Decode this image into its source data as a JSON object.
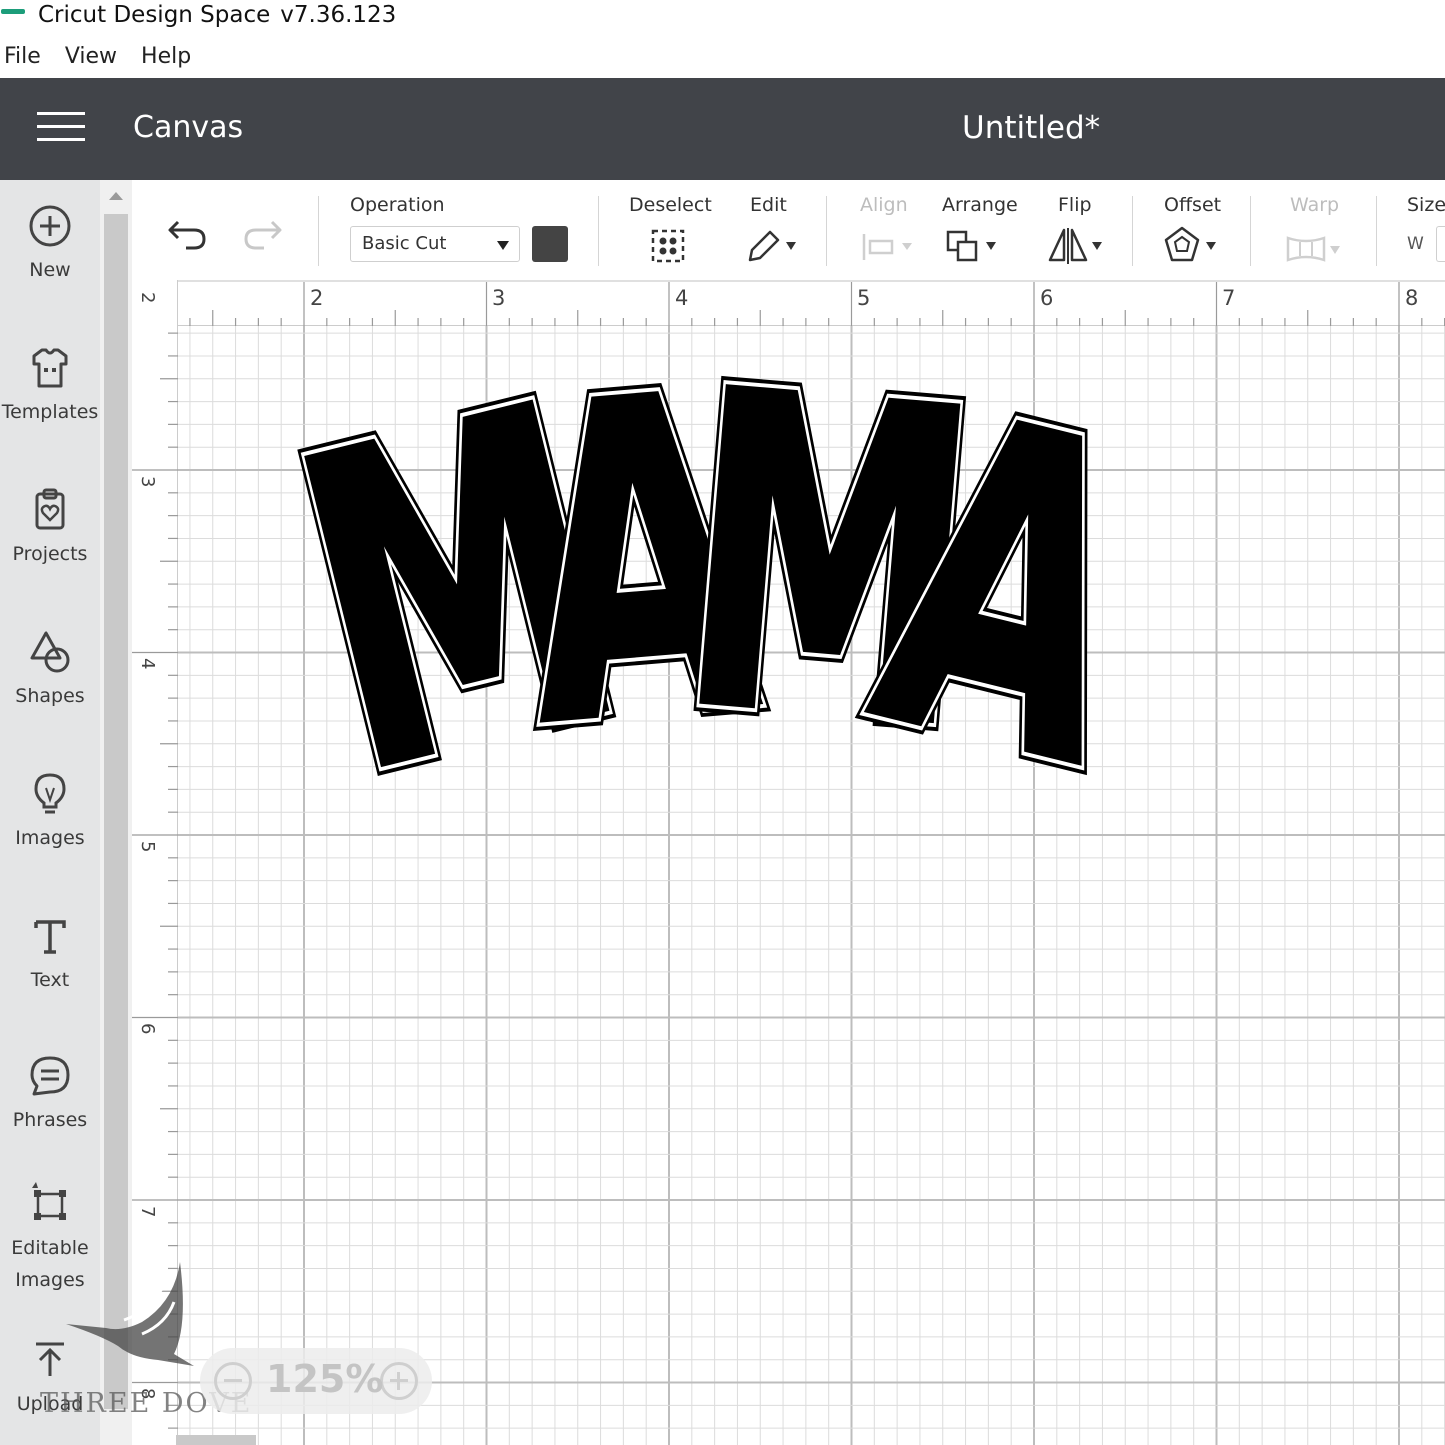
{
  "titlebar": {
    "app_name": "Cricut Design Space",
    "version": "v7.36.123"
  },
  "menu": [
    "File",
    "View",
    "Help"
  ],
  "header": {
    "section": "Canvas",
    "project_title": "Untitled*"
  },
  "sidebar": {
    "items": [
      {
        "label": "New",
        "icon": "plus-circle-icon"
      },
      {
        "label": "Templates",
        "icon": "shirt-icon"
      },
      {
        "label": "Projects",
        "icon": "clipboard-heart-icon"
      },
      {
        "label": "Shapes",
        "icon": "shapes-icon"
      },
      {
        "label": "Images",
        "icon": "lightbulb-icon"
      },
      {
        "label": "Text",
        "icon": "text-t-icon"
      },
      {
        "label": "Phrases",
        "icon": "speech-bubble-icon"
      },
      {
        "label": "Editable\nImages",
        "icon": "editable-image-icon"
      },
      {
        "label": "Upload",
        "icon": "upload-icon"
      }
    ]
  },
  "toolbar": {
    "operation_label": "Operation",
    "operation_value": "Basic Cut",
    "operation_color": "#444444",
    "deselect": "Deselect",
    "edit": "Edit",
    "align": "Align",
    "arrange": "Arrange",
    "flip": "Flip",
    "offset": "Offset",
    "warp": "Warp",
    "size": "Size",
    "size_w": "W"
  },
  "ruler": {
    "top": [
      "2",
      "3",
      "4",
      "5",
      "6",
      "7",
      "8"
    ],
    "left": [
      "2",
      "3",
      "4",
      "5",
      "6",
      "7",
      "8"
    ]
  },
  "canvas": {
    "design_text": "MAMA",
    "fill": "#000000",
    "outline": "#ffffff"
  },
  "zoom": {
    "level": "125%"
  },
  "watermark": {
    "text": "THREE DOVE"
  }
}
